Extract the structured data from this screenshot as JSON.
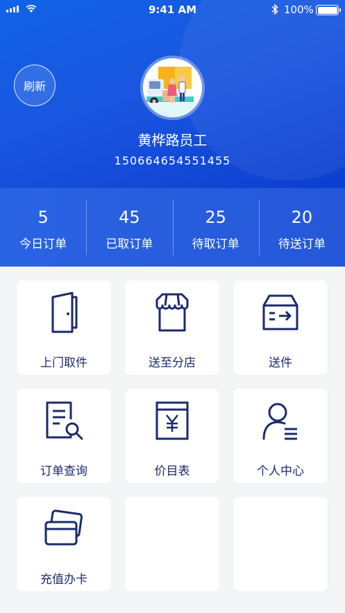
{
  "status_bar": {
    "time": "9:41 AM",
    "battery": "100%"
  },
  "header": {
    "refresh_label": "刷新",
    "user_name": "黄桦路员工",
    "user_phone": "15066465455145​5"
  },
  "stats": [
    {
      "value": "5",
      "label": "今日订单"
    },
    {
      "value": "45",
      "label": "已取订单"
    },
    {
      "value": "25",
      "label": "待取订单"
    },
    {
      "value": "20",
      "label": "待送订单"
    }
  ],
  "menu": [
    {
      "label": "上门取件",
      "icon": "door-icon"
    },
    {
      "label": "送至分店",
      "icon": "store-icon"
    },
    {
      "label": "送件",
      "icon": "delivery-box-icon"
    },
    {
      "label": "订单查询",
      "icon": "document-search-icon"
    },
    {
      "label": "价目表",
      "icon": "price-list-icon"
    },
    {
      "label": "个人中心",
      "icon": "user-profile-icon"
    },
    {
      "label": "充值办卡",
      "icon": "cards-icon"
    },
    {
      "label": "",
      "icon": ""
    },
    {
      "label": "",
      "icon": ""
    }
  ],
  "colors": {
    "primary": "#1a56e0",
    "icon_navy": "#1a2a6b",
    "background": "#f4f5f7"
  }
}
